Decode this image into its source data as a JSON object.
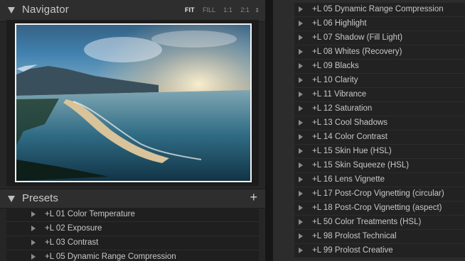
{
  "navigator": {
    "title": "Navigator",
    "zoom_options": [
      "FIT",
      "FILL",
      "1:1",
      "2:1"
    ],
    "active_zoom": "FIT",
    "zoom_stepper_icon": "up-down-arrows-icon"
  },
  "presets": {
    "title": "Presets",
    "add_icon": "plus-icon",
    "left_items": [
      "+L 01 Color Temperature",
      "+L 02 Exposure",
      "+L 03 Contrast",
      "+L 05 Dynamic Range Compression"
    ],
    "right_items": [
      "+L 05 Dynamic Range Compression",
      "+L 06 Highlight",
      "+L 07 Shadow (Fill Light)",
      "+L 08 Whites (Recovery)",
      "+L 09 Blacks",
      "+L 10 Clarity",
      "+L 11 Vibrance",
      "+L 12 Saturation",
      "+L 13 Cool Shadows",
      "+L 14 Color Contrast",
      "+L 15 Skin Hue (HSL)",
      "+L 15 Skin Squeeze (HSL)",
      "+L 16 Lens Vignette",
      "+L 17 Post-Crop Vignetting (circular)",
      "+L 18 Post-Crop Vignetting (aspect)",
      "+L 50 Color Treatments (HSL)",
      "+L 98 Prolost Technical",
      "+L 99 Prolost Creative"
    ]
  },
  "colors": {
    "panel_bg": "#262626",
    "header_bg": "#2e2e2e",
    "list_bg": "#1f1f1f",
    "text": "#c8c8c8",
    "active_zoom": "#e8e8e8",
    "image_border": "#f4f4f4"
  }
}
